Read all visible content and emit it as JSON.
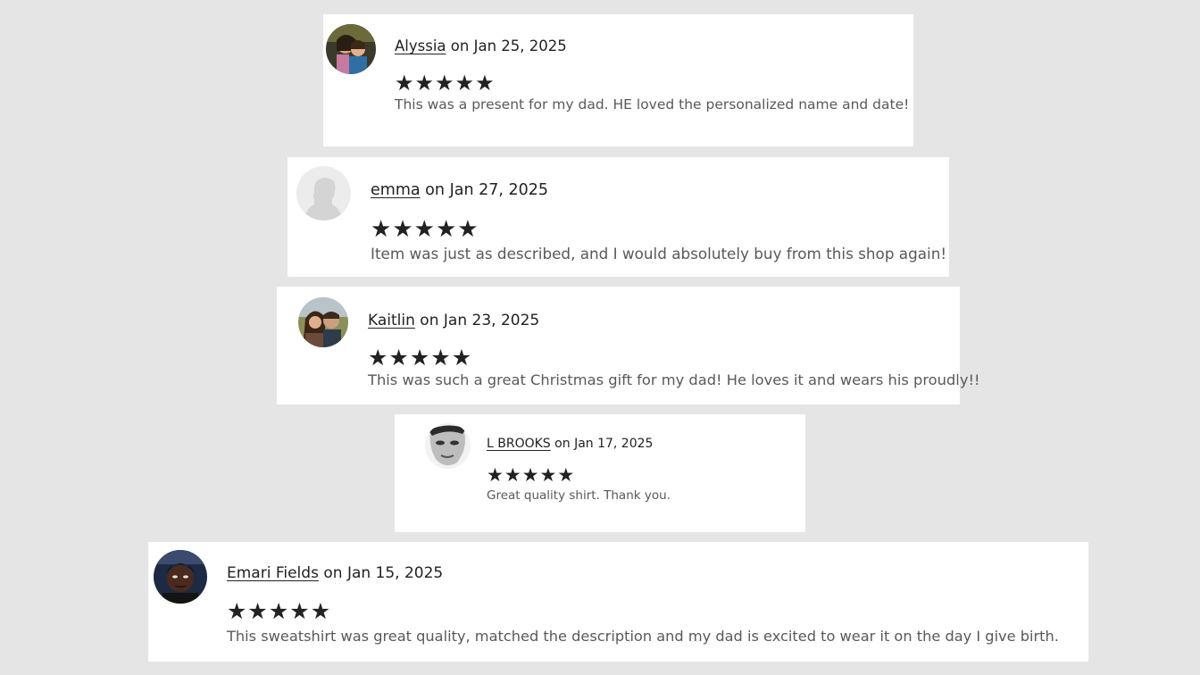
{
  "reviews": [
    {
      "reviewer": "Alyssia",
      "date_prefix": "on",
      "date": "Jan 25, 2025",
      "rating": 5,
      "text": "This was a present for my dad. HE loved the personalized name and date!",
      "avatar": "photo-avatar"
    },
    {
      "reviewer": "emma",
      "date_prefix": "on",
      "date": "Jan 27, 2025",
      "rating": 5,
      "text": "Item was just as described, and I would absolutely buy from this shop again!",
      "avatar": "default-person-avatar"
    },
    {
      "reviewer": "Kaitlin",
      "date_prefix": "on",
      "date": "Jan 23, 2025",
      "rating": 5,
      "text": "This was such a great Christmas gift for my dad! He loves it and wears his proudly!!",
      "avatar": "photo-avatar"
    },
    {
      "reviewer": "L BROOKS",
      "date_prefix": "on",
      "date": "Jan 17, 2025",
      "rating": 5,
      "text": "Great quality shirt. Thank you.",
      "avatar": "photo-avatar"
    },
    {
      "reviewer": "Emari Fields",
      "date_prefix": "on",
      "date": "Jan 15, 2025",
      "rating": 5,
      "text": "This sweatshirt was great quality, matched the description and my dad is excited to wear it on the day I give birth.",
      "avatar": "photo-avatar"
    }
  ],
  "star_glyph": "★",
  "colors": {
    "background": "#e5e5e5",
    "card": "#ffffff",
    "text": "#222222",
    "review_text": "#595959"
  }
}
